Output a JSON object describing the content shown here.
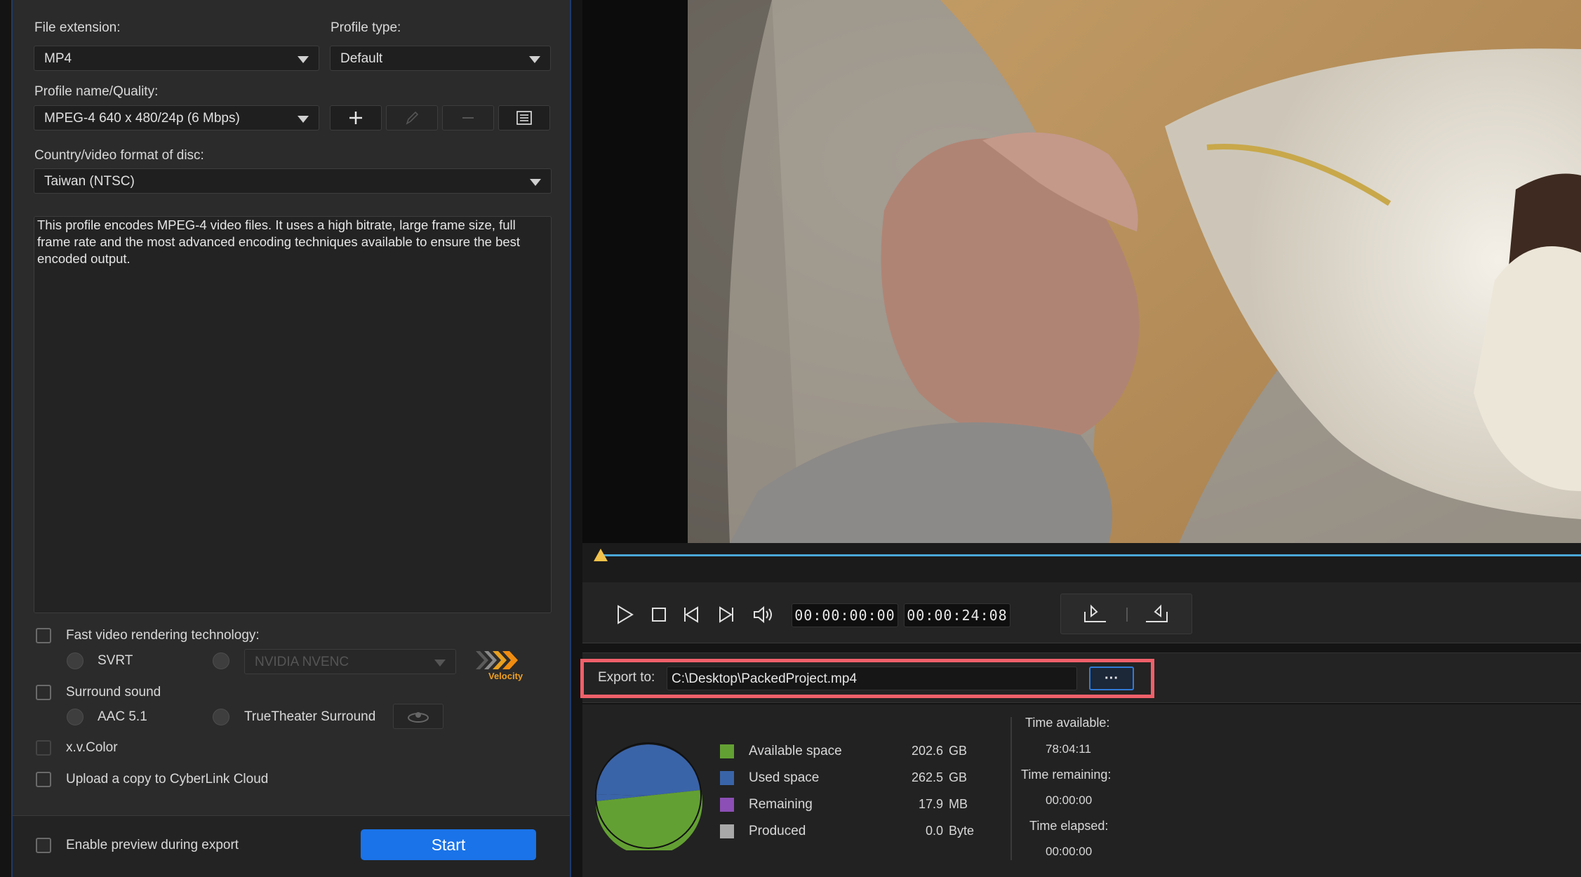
{
  "profile": {
    "file_extension_label": "File extension:",
    "file_extension_value": "MP4",
    "profile_type_label": "Profile type:",
    "profile_type_value": "Default",
    "profile_name_label": "Profile name/Quality:",
    "profile_name_value": "MPEG-4 640 x 480/24p (6 Mbps)",
    "country_label": "Country/video format of disc:",
    "country_value": "Taiwan (NTSC)",
    "description": "This profile encodes MPEG-4 video files. It uses a high bitrate, large frame size, full frame rate and the most advanced encoding techniques available to ensure the best encoded output."
  },
  "options": {
    "fast_rendering_label": "Fast video rendering technology:",
    "svrt_label": "SVRT",
    "encoder_value": "NVIDIA NVENC",
    "velocity_logo_text": "Velocity",
    "surround_label": "Surround sound",
    "aac_label": "AAC 5.1",
    "truetheater_label": "TrueTheater Surround",
    "xvcolor_label": "x.v.Color",
    "cloud_label": "Upload a copy to CyberLink Cloud",
    "preview_label": "Enable preview during export",
    "start_label": "Start"
  },
  "player": {
    "current_time": "00:00:00:00",
    "duration": "00:00:24:08"
  },
  "export": {
    "label": "Export to:",
    "path": "C:\\Desktop\\PackedProject.mp4",
    "browse_label": "···"
  },
  "disk": {
    "items": [
      {
        "label": "Available space",
        "value": "202.6",
        "unit": "GB",
        "color": "#63a033"
      },
      {
        "label": "Used space",
        "value": "262.5",
        "unit": "GB",
        "color": "#3a64a8"
      },
      {
        "label": "Remaining",
        "value": "17.9",
        "unit": "MB",
        "color": "#8c4fb5"
      },
      {
        "label": "Produced",
        "value": "0.0",
        "unit": "Byte",
        "color": "#a8a8a8"
      }
    ],
    "time_available_label": "Time available:",
    "time_available_value": "78:04:11",
    "time_remaining_label": "Time remaining:",
    "time_remaining_value": "00:00:00",
    "time_elapsed_label": "Time elapsed:",
    "time_elapsed_value": "00:00:00"
  },
  "colors": {
    "accent_blue": "#1a73e8",
    "highlight_red": "#f0606a",
    "timeline_blue": "#4aa8d8"
  }
}
